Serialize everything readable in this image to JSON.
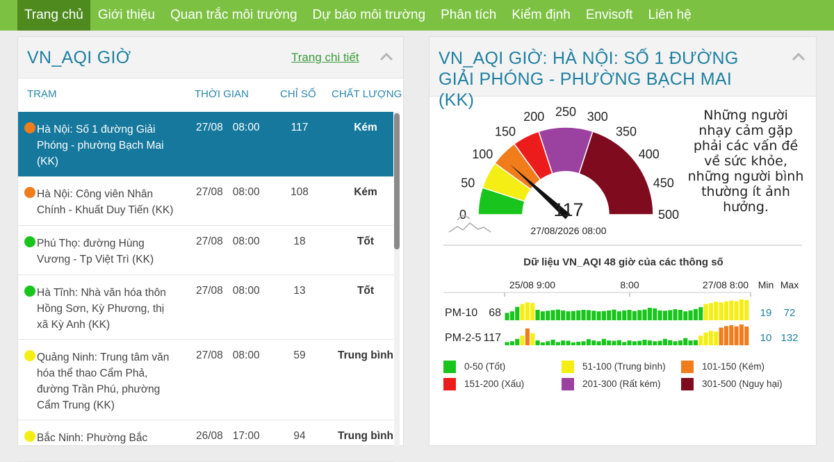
{
  "nav": {
    "items": [
      "Trang chủ",
      "Giới thiệu",
      "Quan trắc môi trường",
      "Dự báo môi trường",
      "Phân tích",
      "Kiểm định",
      "Envisoft",
      "Liên hệ"
    ],
    "active_index": 0
  },
  "left_panel": {
    "title": "VN_AQI GIỜ",
    "detail_link": "Trang chi tiết",
    "columns": [
      "TRẠM",
      "THỜI GIAN",
      "CHỈ SỐ",
      "CHẤT LƯỢNG"
    ],
    "rows": [
      {
        "station": "Hà Nội: Số 1 đường Giải Phóng - phường Bạch Mai (KK)",
        "date": "27/08",
        "hour": "08:00",
        "index": "117",
        "quality": "Kém",
        "color": "#f07c1c",
        "selected": true
      },
      {
        "station": "Hà Nội: Công viên Nhân Chính - Khuất Duy Tiến (KK)",
        "date": "27/08",
        "hour": "08:00",
        "index": "108",
        "quality": "Kém",
        "color": "#f07c1c",
        "selected": false
      },
      {
        "station": "Phú Thọ: đường Hùng Vương - Tp Việt Trì (KK)",
        "date": "27/08",
        "hour": "08:00",
        "index": "18",
        "quality": "Tốt",
        "color": "#19c51c",
        "selected": false
      },
      {
        "station": "Hà Tĩnh: Nhà văn hóa thôn Hồng Sơn, Kỳ Phương, thị xã Kỳ Anh (KK)",
        "date": "27/08",
        "hour": "08:00",
        "index": "13",
        "quality": "Tốt",
        "color": "#19c51c",
        "selected": false
      },
      {
        "station": "Quảng Ninh: Trung tâm văn hóa thể thao Cẩm Phả, đường Trần Phú, phường Cẩm Trung (KK)",
        "date": "27/08",
        "hour": "08:00",
        "index": "59",
        "quality": "Trung bình",
        "color": "#f5ee14",
        "selected": false
      },
      {
        "station": "Bắc Ninh: Phường Bắc",
        "date": "26/08",
        "hour": "17:00",
        "index": "94",
        "quality": "Trung bình",
        "color": "#f5ee14",
        "selected": false
      }
    ]
  },
  "right_panel": {
    "title": "VN_AQI GIỜ: HÀ NỘI: SỐ 1 ĐƯỜNG GIẢI PHÓNG - PHƯỜNG BẠCH MAI (KK)",
    "gauge": {
      "value": 117,
      "value_label": "117",
      "timestamp": "27/08/2026 08:00",
      "tick_labels": [
        "0",
        "50",
        "100",
        "150",
        "200",
        "250",
        "300",
        "350",
        "400",
        "450",
        "500"
      ],
      "max": 500
    },
    "advice": "Những người nhạy cảm gặp phải các vấn đề về sức khỏe, những người bình thường ít ảnh hưởng.",
    "chart": {
      "title": "Dữ liệu VN_AQI 48 giờ của các thông số",
      "time_labels": [
        "25/08 9:00",
        "8:00",
        "27/08 8:00"
      ],
      "min_label": "Min",
      "max_label": "Max",
      "series": [
        {
          "name": "PM-10",
          "current": "68",
          "min": "19",
          "max": "72",
          "values": [
            25,
            30,
            45,
            55,
            60,
            58,
            35,
            30,
            32,
            34,
            36,
            33,
            30,
            31,
            33,
            35,
            34,
            32,
            30,
            31,
            33,
            36,
            30,
            33,
            35,
            31,
            34,
            36,
            42,
            40,
            33,
            32,
            34,
            37,
            35,
            30,
            33,
            38,
            44,
            55,
            58,
            62,
            60,
            63,
            66,
            64,
            70,
            68
          ]
        },
        {
          "name": "PM-2-5",
          "current": "117",
          "min": "10",
          "max": "132",
          "values": [
            20,
            25,
            40,
            60,
            105,
            75,
            30,
            18,
            25,
            35,
            20,
            30,
            28,
            18,
            22,
            25,
            38,
            30,
            25,
            40,
            30,
            28,
            32,
            20,
            30,
            25,
            28,
            35,
            30,
            25,
            28,
            40,
            32,
            25,
            30,
            45,
            30,
            32,
            60,
            80,
            90,
            85,
            110,
            120,
            125,
            118,
            130,
            117
          ]
        }
      ]
    },
    "legend": [
      {
        "label": "0-50 (Tốt)",
        "color": "#19c51c"
      },
      {
        "label": "51-100 (Trung bình)",
        "color": "#f5ee14"
      },
      {
        "label": "101-150 (Kém)",
        "color": "#f07c1c"
      },
      {
        "label": "151-200 (Xấu)",
        "color": "#ec1c1c"
      },
      {
        "label": "201-300 (Rất kém)",
        "color": "#9b41a0"
      },
      {
        "label": "301-500 (Nguy hại)",
        "color": "#7e0b1e"
      }
    ]
  }
}
